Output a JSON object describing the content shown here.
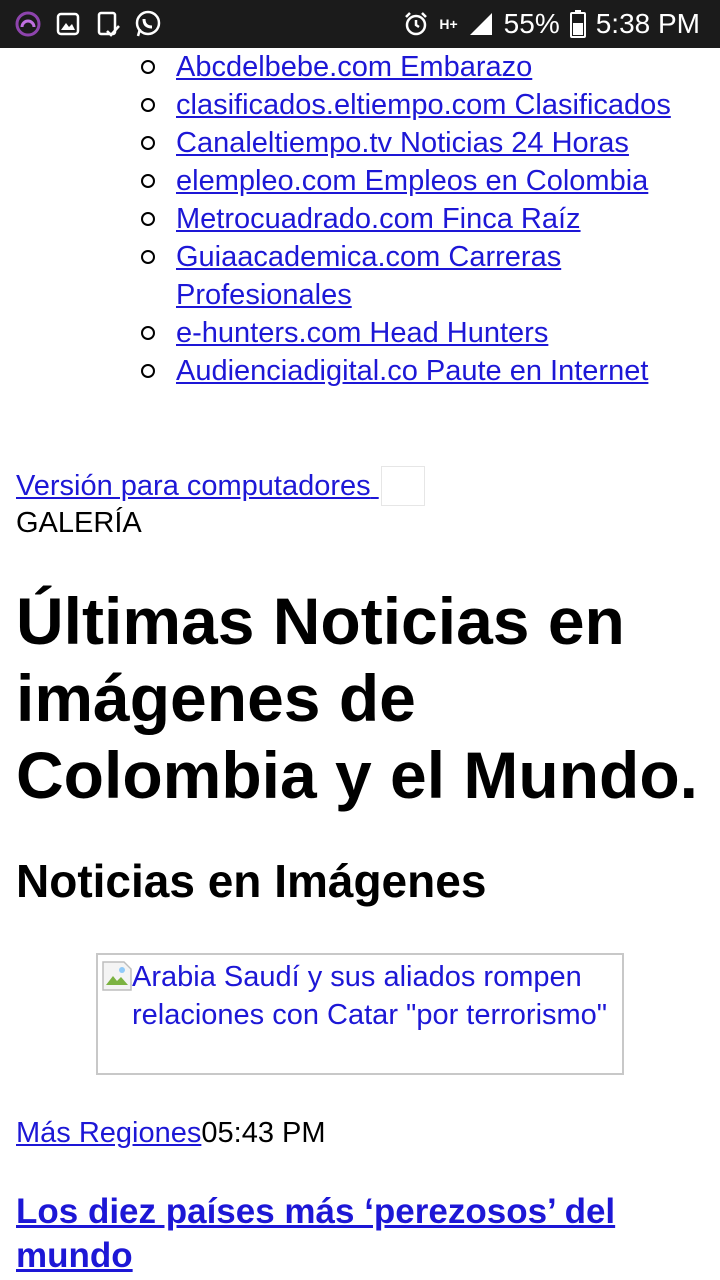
{
  "status_bar": {
    "battery": "55%",
    "time": "5:38 PM",
    "network": "H+",
    "icons": [
      "app-circle-icon",
      "image-icon",
      "clipboard-check-icon",
      "whatsapp-icon",
      "alarm-icon",
      "network-h-plus-icon",
      "signal-icon",
      "battery-icon"
    ]
  },
  "site_links": [
    "Abcdelbebe.com Embarazo",
    "clasificados.eltiempo.com Clasificados",
    "Canaleltiempo.tv Noticias 24 Horas",
    "elempleo.com Empleos en Colombia",
    "Metrocuadrado.com Finca Raíz",
    "Guiaacademica.com Carreras Profesionales",
    "e-hunters.com Head Hunters",
    "Audienciadigital.co Paute en Internet"
  ],
  "desktop_version_link": "Versión para computadores",
  "section_label": "GALERÍA",
  "headline": "Últimas Noticias en imágenes de Colombia y el Mundo.",
  "subheading": "Noticias en Imágenes",
  "featured_image": {
    "alt": "Arabia Saudí y sus aliados rompen relaciones con Catar \"por terrorismo\""
  },
  "story": {
    "category": "Más Regiones",
    "time": "05:43 PM",
    "title": "Los diez países más ‘perezosos’ del mundo"
  },
  "colors": {
    "link": "#1d17d6",
    "status_bar": "#1b1b1b",
    "text": "#000000"
  }
}
